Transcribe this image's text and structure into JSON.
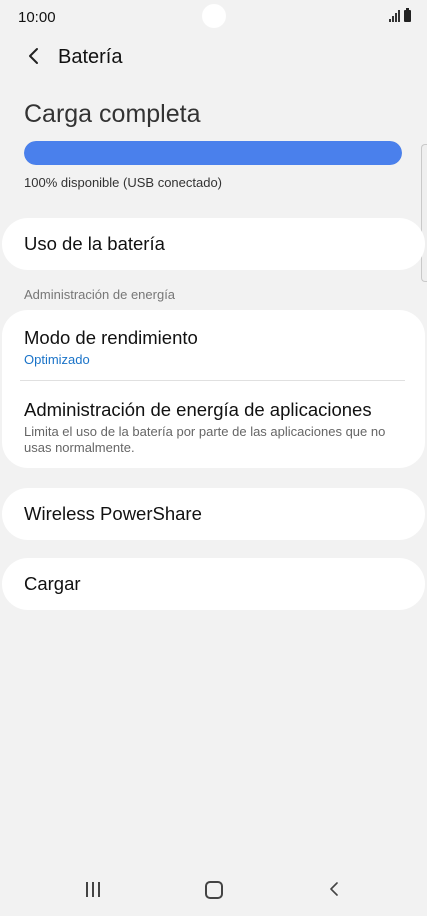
{
  "status_bar": {
    "time": "10:00"
  },
  "header": {
    "title": "Batería"
  },
  "charge": {
    "title": "Carga completa",
    "status": "100% disponible (USB conectado)",
    "level_percent": 100,
    "accent_color": "#4a80ec"
  },
  "items": {
    "battery_usage": "Uso de la batería",
    "section_power": "Administración de energía",
    "performance_mode": {
      "title": "Modo de rendimiento",
      "value": "Optimizado"
    },
    "app_power": {
      "title": "Administración de energía de aplicaciones",
      "description": "Limita el uso de la batería por parte de las aplicaciones que no usas normalmente."
    },
    "wireless_powershare": "Wireless PowerShare",
    "charging": "Cargar"
  },
  "icons": {
    "back": "chevron-left-icon",
    "nav_recents": "recents-icon",
    "nav_home": "home-icon",
    "nav_back": "back-icon"
  }
}
